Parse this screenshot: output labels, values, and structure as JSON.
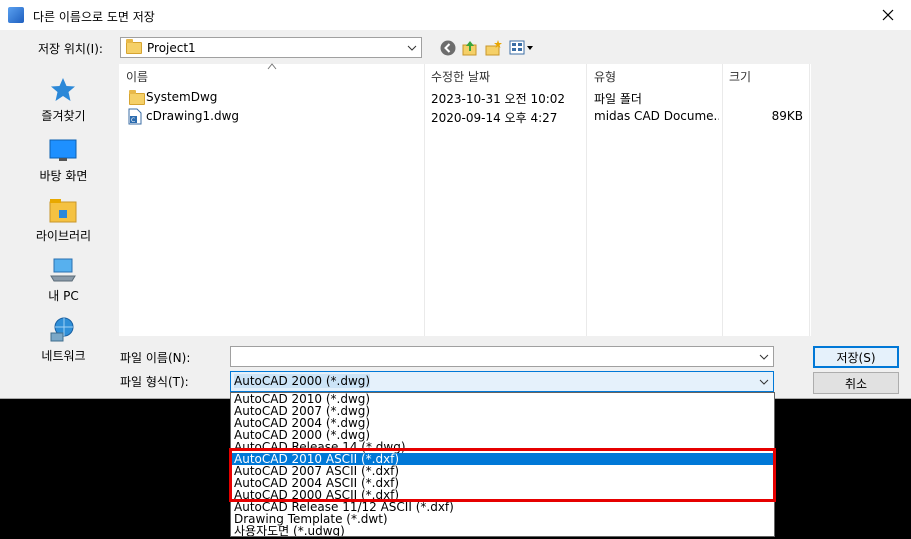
{
  "window": {
    "title": "다른 이름으로 도면 저장"
  },
  "toolbar": {
    "look_in_label": "저장 위치(I):",
    "look_in_value": "Project1"
  },
  "places": [
    {
      "label": "즐겨찾기",
      "icon": "star-icon"
    },
    {
      "label": "바탕 화면",
      "icon": "desktop-icon"
    },
    {
      "label": "라이브러리",
      "icon": "library-icon"
    },
    {
      "label": "내 PC",
      "icon": "computer-icon"
    },
    {
      "label": "네트워크",
      "icon": "network-icon"
    }
  ],
  "columns": {
    "name": "이름",
    "modified": "수정한 날짜",
    "type": "유형",
    "size": "크기"
  },
  "files": [
    {
      "name": "SystemDwg",
      "modified": "2023-10-31 오전 10:02",
      "type": "파일 폴더",
      "size": "",
      "icon": "folder-icon"
    },
    {
      "name": "cDrawing1.dwg",
      "modified": "2020-09-14 오후 4:27",
      "type": "midas CAD Docume...",
      "size": "89KB",
      "icon": "dwg-file-icon"
    }
  ],
  "form": {
    "file_name_label": "파일 이름(N):",
    "file_name_value": "",
    "file_type_label": "파일 형식(T):",
    "file_type_value": "AutoCAD 2000 (*.dwg)",
    "save_label": "저장(S)",
    "cancel_label": "취소"
  },
  "file_type_options": [
    {
      "label": "AutoCAD 2010 (*.dwg)",
      "selected": false
    },
    {
      "label": "AutoCAD 2007 (*.dwg)",
      "selected": false
    },
    {
      "label": "AutoCAD 2004 (*.dwg)",
      "selected": false
    },
    {
      "label": "AutoCAD 2000 (*.dwg)",
      "selected": false
    },
    {
      "label": "AutoCAD Release 14 (*.dwg)",
      "selected": false
    },
    {
      "label": "AutoCAD 2010 ASCII (*.dxf)",
      "selected": true
    },
    {
      "label": "AutoCAD 2007 ASCII (*.dxf)",
      "selected": false
    },
    {
      "label": "AutoCAD 2004 ASCII (*.dxf)",
      "selected": false
    },
    {
      "label": "AutoCAD 2000 ASCII (*.dxf)",
      "selected": false
    },
    {
      "label": "AutoCAD Release 11/12 ASCII (*.dxf)",
      "selected": false
    },
    {
      "label": "Drawing Template (*.dwt)",
      "selected": false
    },
    {
      "label": "사용자도면 (*.udwg)",
      "selected": false
    }
  ],
  "colors": {
    "selection": "#0078d7",
    "highlight_annotation": "#e60000"
  }
}
